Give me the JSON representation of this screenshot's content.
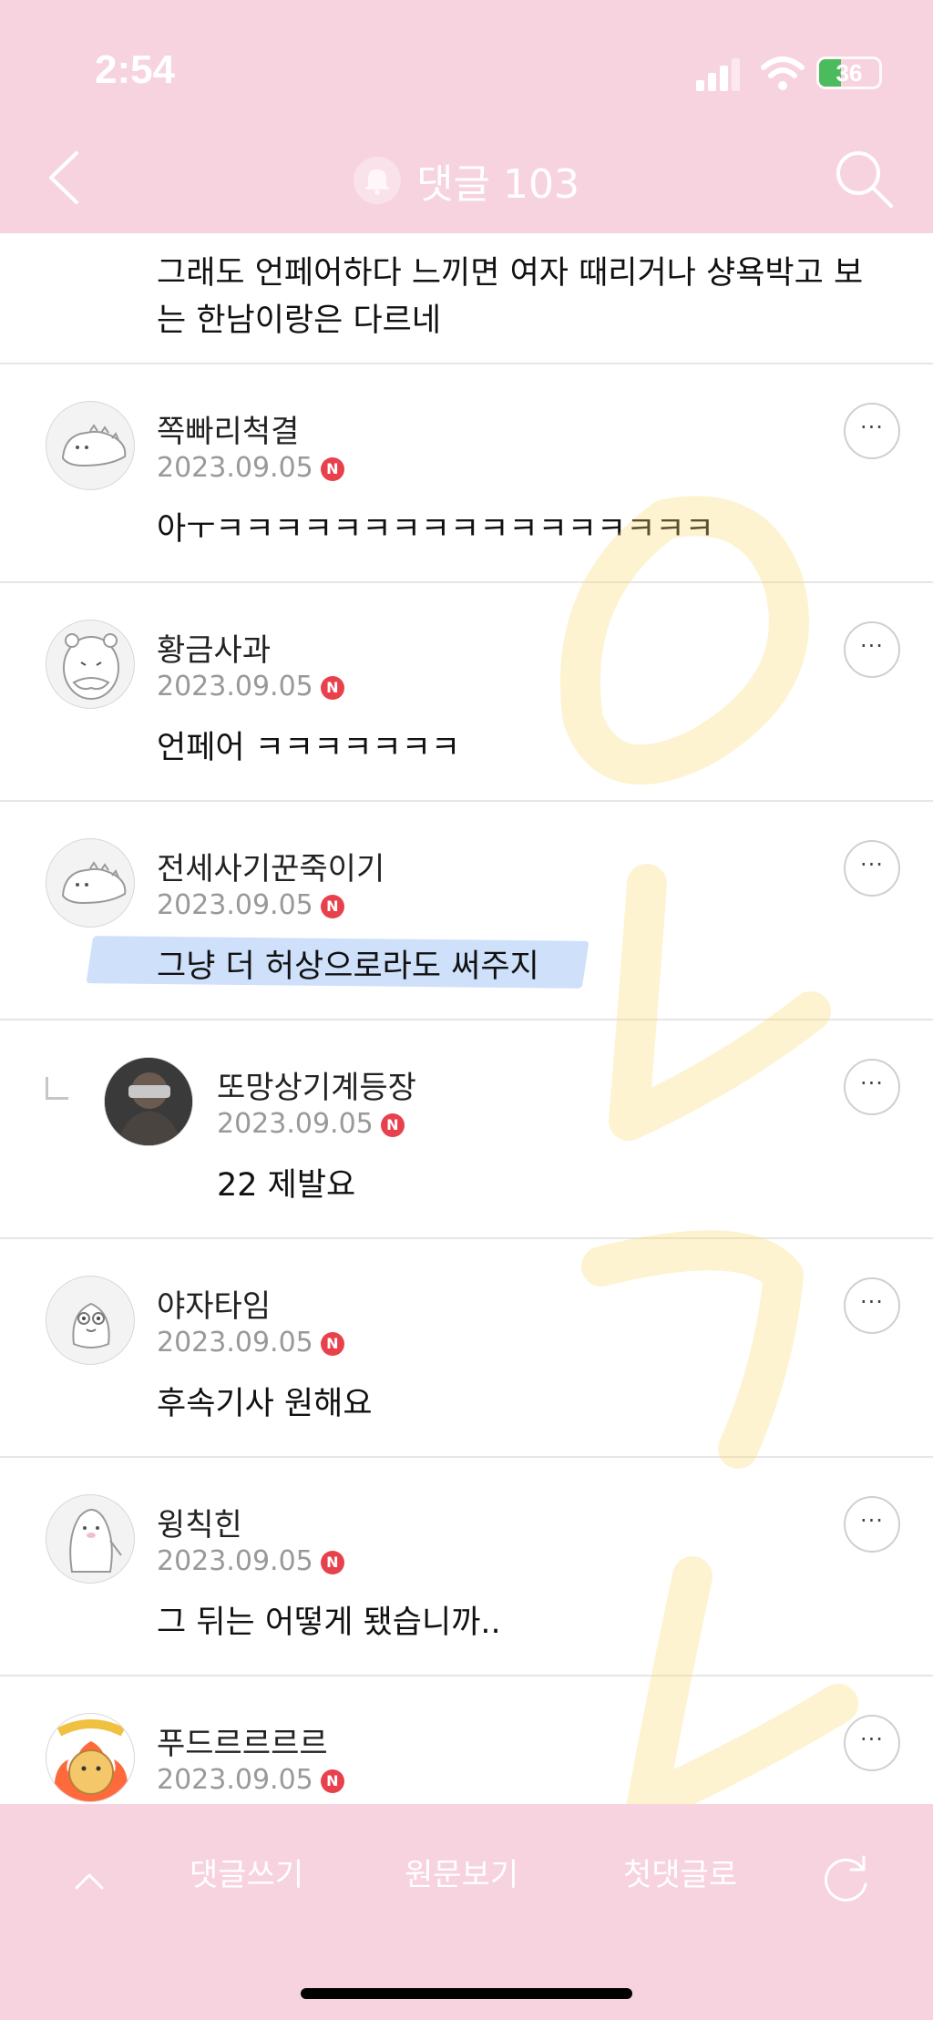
{
  "status_bar": {
    "time": "2:54",
    "battery": "36",
    "battery_level": 0.36
  },
  "header": {
    "title": "댓글 103",
    "icons": [
      "back-arrow-icon",
      "bell-icon",
      "search-icon"
    ]
  },
  "first_comment": {
    "text_line1": "그래도 언페어하다 느끼면 여자 때리거나 샹욕박고 보",
    "text_line2": "는 한남이랑은 다르네"
  },
  "comments": [
    {
      "author": "쪽빠리척결",
      "date": "2023.09.05",
      "badge": "N",
      "text": "아ㅜㅋㅋㅋㅋㅋㅋㅋㅋㅋㅋㅋㅋㅋㅋㅋㅋㅋ",
      "more": "···"
    },
    {
      "author": "황금사과",
      "date": "2023.09.05",
      "badge": "N",
      "text": "언페어 ㅋㅋㅋㅋㅋㅋㅋ",
      "more": "···"
    },
    {
      "author": "전세사기꾼죽이기",
      "date": "2023.09.05",
      "badge": "N",
      "text": "그냥 더 허상으로라도 써주지",
      "more": "···"
    },
    {
      "author": "또망상기계등장",
      "date": "2023.09.05",
      "badge": "N",
      "text": "22 제발요",
      "more": "···"
    },
    {
      "author": "야자타임",
      "date": "2023.09.05",
      "badge": "N",
      "text": "후속기사 원해요",
      "more": "···"
    },
    {
      "author": "윙칙힌",
      "date": "2023.09.05",
      "badge": "N",
      "text": "그 뒤는 어떻게 됐습니까..",
      "more": "···"
    },
    {
      "author": "푸드르르르르",
      "date": "2023.09.05",
      "badge": "N",
      "text": "",
      "more": "···"
    }
  ],
  "bottom_bar": {
    "write_comment": "댓글쓰기",
    "view_original": "원문보기",
    "first_comment": "첫댓글로"
  },
  "colors": {
    "bar_pink": "#f7d3df",
    "badge_red": "#e8414e",
    "highlight_blue": "#cfe0fb"
  }
}
